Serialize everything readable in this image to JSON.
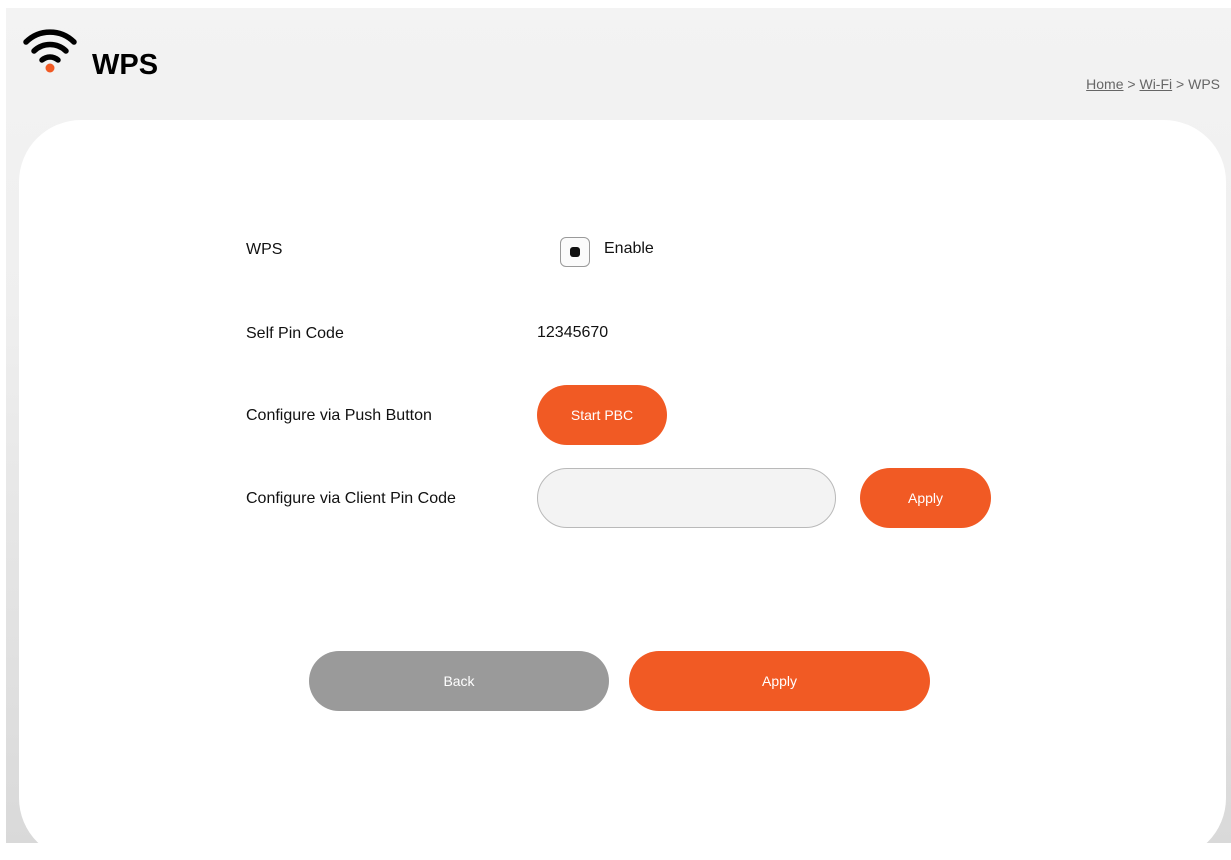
{
  "header": {
    "title": "WPS",
    "icon": "wifi-icon",
    "accent_color": "#f15a24"
  },
  "breadcrumb": {
    "home": "Home",
    "sep1": ">",
    "wifi": "Wi-Fi",
    "sep2": ">",
    "current": "WPS"
  },
  "form": {
    "wps_label": "WPS",
    "enable_label": "Enable",
    "enable_checked": true,
    "self_pin_label": "Self Pin Code",
    "self_pin_value": "12345670",
    "push_button_label": "Configure via Push Button",
    "start_pbc_label": "Start PBC",
    "client_pin_label": "Configure via Client Pin Code",
    "client_pin_value": "",
    "client_pin_placeholder": "",
    "client_pin_apply_label": "Apply"
  },
  "footer": {
    "back_label": "Back",
    "apply_label": "Apply",
    "back_color": "#9a9a9a",
    "apply_color": "#f15a24"
  }
}
